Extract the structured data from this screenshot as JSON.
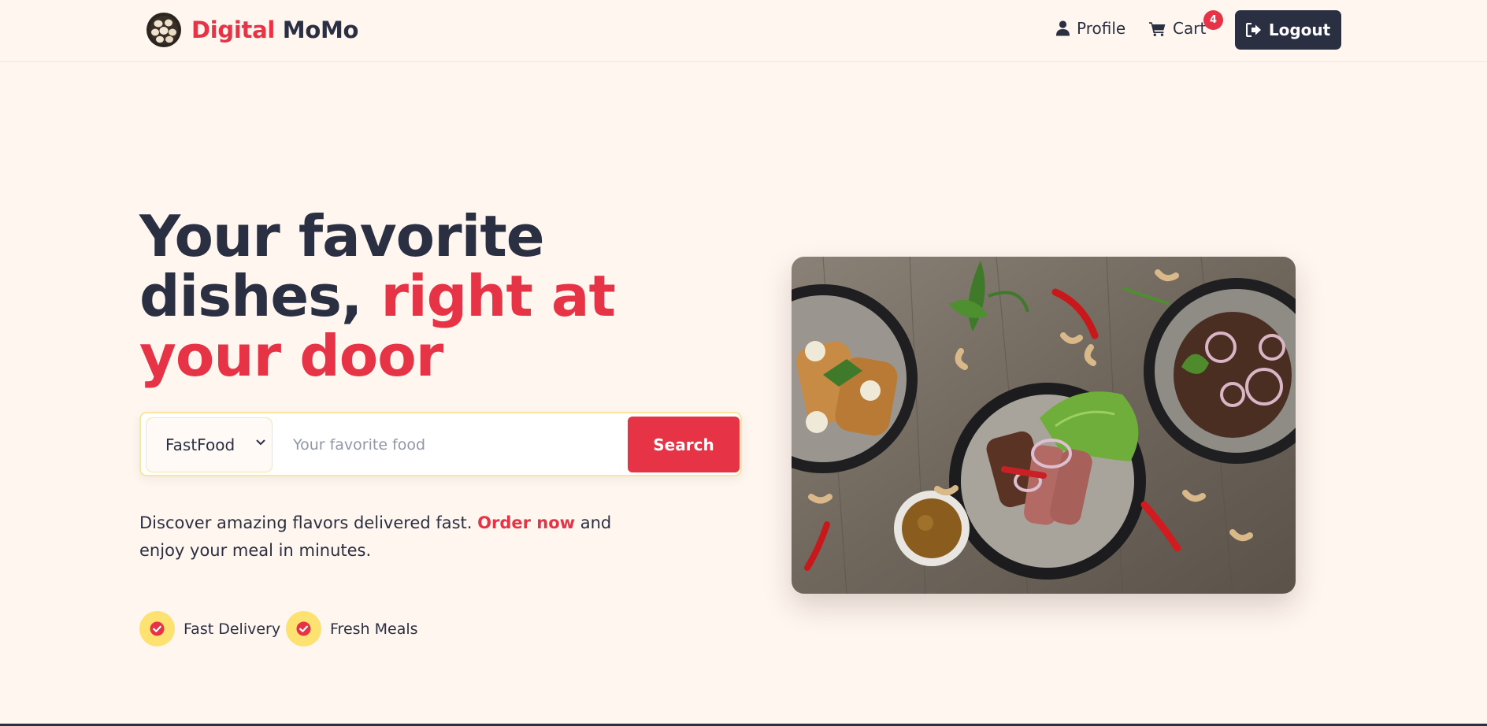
{
  "brand": {
    "word1": "Digital",
    "word2": "MoMo",
    "logo_icon": "momo-plate-logo"
  },
  "nav": {
    "profile_label": "Profile",
    "cart_label": "Cart",
    "cart_count": "4",
    "logout_label": "Logout"
  },
  "hero": {
    "title_line1": "Your favorite",
    "title_line2_plain": "dishes, ",
    "title_line2_accent": "right at",
    "title_line3_accent": "your door",
    "description_part1": "Discover amazing flavors delivered fast. ",
    "description_link": "Order now",
    "description_part2": " and enjoy your meal in minutes.",
    "image_icon": "food-platter-photo"
  },
  "search": {
    "category_value": "FastFood",
    "input_placeholder": "Your favorite food",
    "input_value": "",
    "button_label": "Search"
  },
  "features": [
    {
      "label": "Fast Delivery",
      "icon": "check-circle-icon"
    },
    {
      "label": "Fresh Meals",
      "icon": "check-circle-icon"
    }
  ],
  "colors": {
    "background": "#fff6f0",
    "accent": "#e63346",
    "dark": "#2b2f42",
    "badge_yellow": "#fde272"
  }
}
